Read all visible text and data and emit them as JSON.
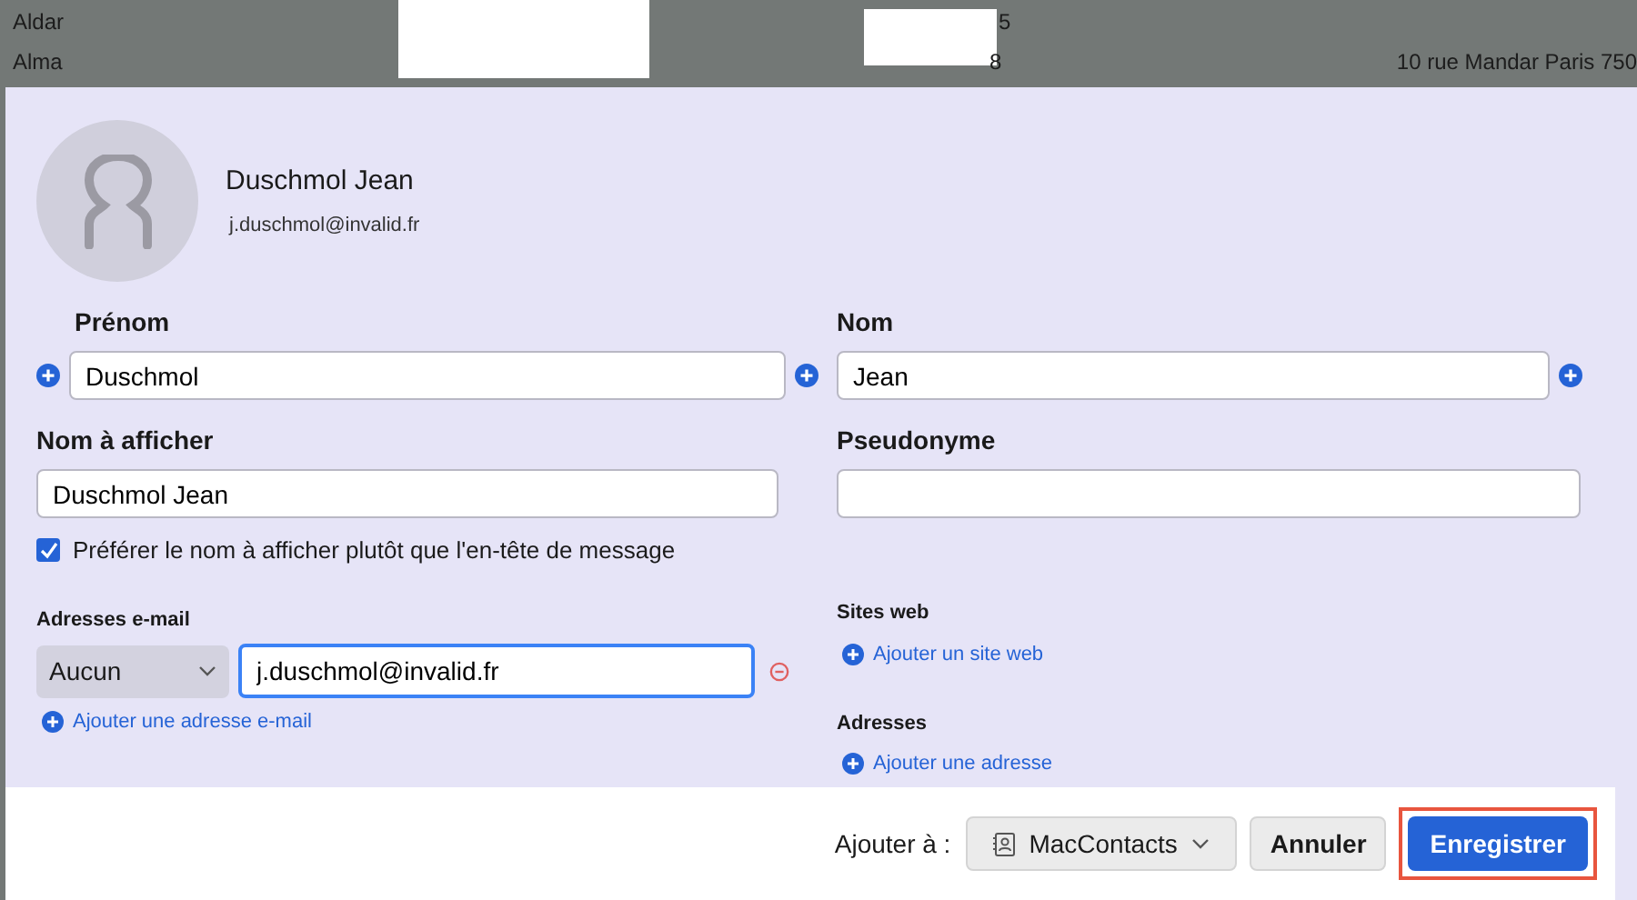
{
  "background_list": {
    "rows": [
      {
        "name": "Aldar",
        "column_3": "5"
      },
      {
        "name": "Alma",
        "column_3": "8",
        "column_4": "10 rue Mandar Paris 750"
      }
    ]
  },
  "contact": {
    "display_name": "Duschmol Jean",
    "email": "j.duschmol@invalid.fr"
  },
  "fields": {
    "first_name": {
      "label": "Prénom",
      "value": "Duschmol"
    },
    "last_name": {
      "label": "Nom",
      "value": "Jean"
    },
    "display_name": {
      "label": "Nom à afficher",
      "value": "Duschmol Jean"
    },
    "nickname": {
      "label": "Pseudonyme"
    }
  },
  "prefer_display_name": {
    "label": "Préférer le nom à afficher plutôt que l'en-tête de message",
    "checked": true
  },
  "emails": {
    "label": "Adresses e-mail",
    "type": "Aucun",
    "value": "j.duschmol@invalid.fr",
    "add_link": "Ajouter une adresse e-mail"
  },
  "websites": {
    "label": "Sites web",
    "add_link": "Ajouter un site web"
  },
  "addresses": {
    "label": "Adresses",
    "add_link": "Ajouter une adresse"
  },
  "footer": {
    "add_to_label": "Ajouter à :",
    "address_book": "MacContacts",
    "cancel": "Annuler",
    "save": "Enregistrer",
    "save_highlighted": true
  }
}
